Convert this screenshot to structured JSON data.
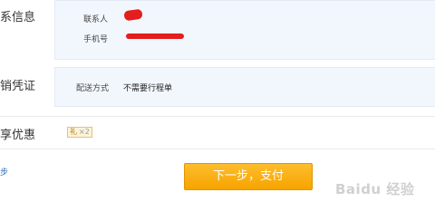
{
  "contact_section": {
    "title": "系信息",
    "contact_label": "联系人",
    "phone_label": "手机号"
  },
  "delivery_section": {
    "title": "销凭证",
    "method_label": "配送方式",
    "method_value": "不需要行程单"
  },
  "discount_section": {
    "title": "享优惠",
    "coupon_tag": "礼",
    "coupon_qty": "×2"
  },
  "actions": {
    "prev_label": "步",
    "next_label": "下一步，支付"
  },
  "watermark": "Baidu 经验",
  "colors": {
    "panel_bg": "#f2f7fd",
    "button": "#f9ad14",
    "link": "#2c6db3",
    "redaction": "#e41d1d"
  }
}
